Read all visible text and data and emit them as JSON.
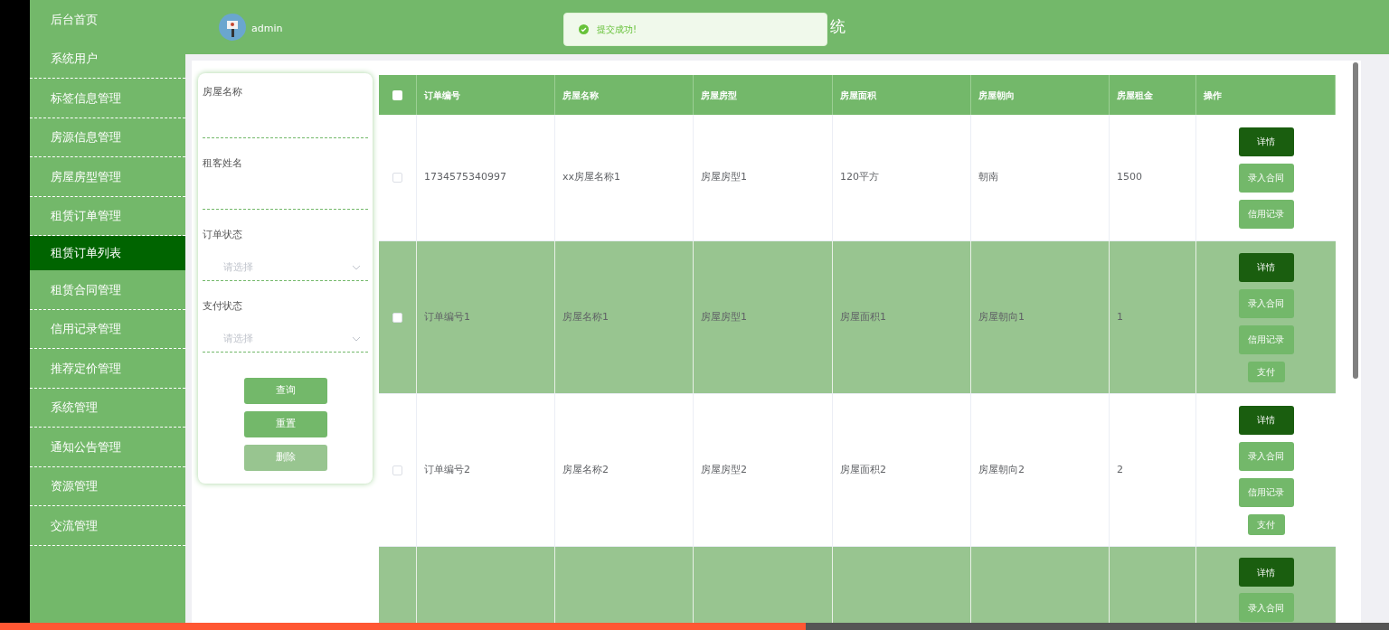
{
  "sidebar": {
    "items": [
      {
        "label": "后台首页",
        "selected": false
      },
      {
        "label": "系统用户",
        "selected": false
      },
      {
        "label": "标签信息管理",
        "selected": false
      },
      {
        "label": "房源信息管理",
        "selected": false
      },
      {
        "label": "房屋房型管理",
        "selected": false
      },
      {
        "label": "租赁订单管理",
        "selected": false
      },
      {
        "label": "租赁订单列表",
        "selected": true
      },
      {
        "label": "租赁合同管理",
        "selected": false
      },
      {
        "label": "信用记录管理",
        "selected": false
      },
      {
        "label": "推荐定价管理",
        "selected": false
      },
      {
        "label": "系统管理",
        "selected": false
      },
      {
        "label": "通知公告管理",
        "selected": false
      },
      {
        "label": "资源管理",
        "selected": false
      },
      {
        "label": "交流管理",
        "selected": false
      }
    ]
  },
  "header": {
    "username": "admin",
    "title": "统"
  },
  "toast": {
    "message": "提交成功!"
  },
  "filters": {
    "fields": [
      {
        "kind": "text",
        "label": "房屋名称"
      },
      {
        "kind": "text",
        "label": "租客姓名"
      },
      {
        "kind": "select",
        "label": "订单状态",
        "placeholder": "请选择"
      },
      {
        "kind": "select",
        "label": "支付状态",
        "placeholder": "请选择"
      }
    ],
    "buttons": [
      {
        "label": "查询",
        "disabled": false
      },
      {
        "label": "重置",
        "disabled": false
      },
      {
        "label": "删除",
        "disabled": true
      }
    ]
  },
  "table": {
    "select_all": {
      "checked": false
    },
    "columns": [
      "订单编号",
      "房屋名称",
      "房屋房型",
      "房屋面积",
      "房屋朝向",
      "房屋租金",
      "操作"
    ],
    "rows": [
      {
        "checked": false,
        "cells": [
          "1734575340997",
          "xx房屋名称1",
          "房屋房型1",
          "120平方",
          "朝南",
          "1500"
        ],
        "actions": [
          "详情",
          "录入合同",
          "信用记录"
        ]
      },
      {
        "checked": false,
        "cells": [
          "订单编号1",
          "房屋名称1",
          "房屋房型1",
          "房屋面积1",
          "房屋朝向1",
          "1"
        ],
        "actions": [
          "详情",
          "录入合同",
          "信用记录",
          "支付"
        ]
      },
      {
        "checked": false,
        "cells": [
          "订单编号2",
          "房屋名称2",
          "房屋房型2",
          "房屋面积2",
          "房屋朝向2",
          "2"
        ],
        "actions": [
          "详情",
          "录入合同",
          "信用记录",
          "支付"
        ]
      },
      {
        "cells": [],
        "actions": [
          "详情",
          "录入合同"
        ]
      }
    ]
  },
  "video_progress": {
    "level": 0.58
  }
}
